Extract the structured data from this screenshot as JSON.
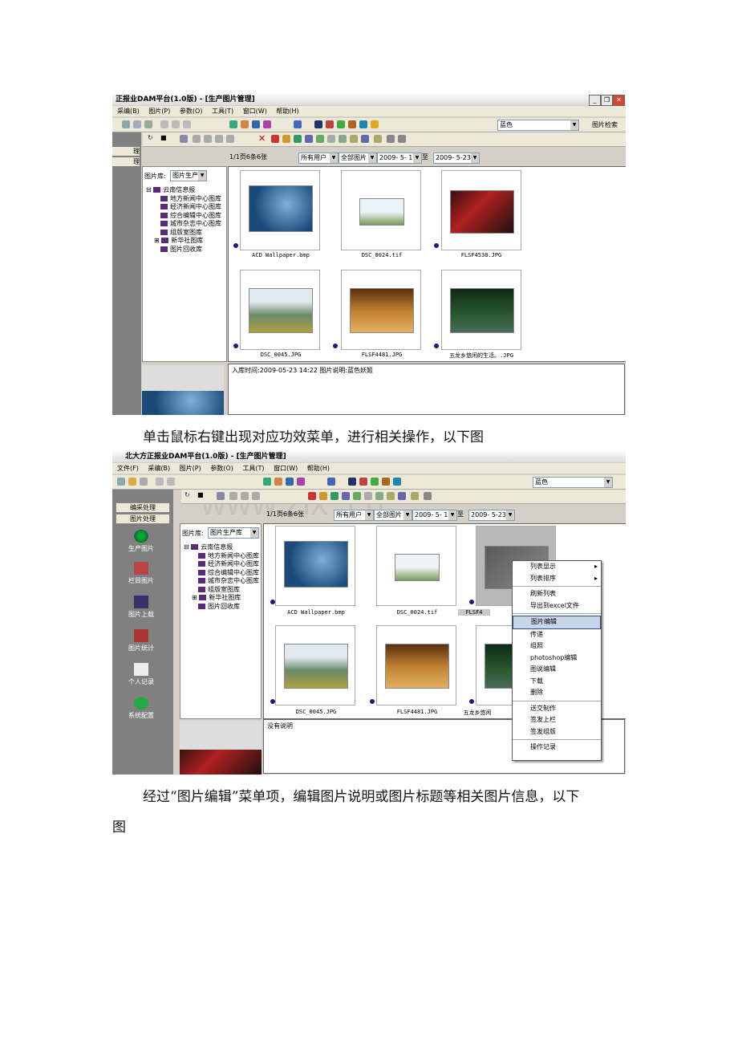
{
  "shot1": {
    "title": "正报业DAM平台(1.0版) - [生产图片管理]",
    "menus": [
      "采编(B)",
      "图片(P)",
      "参数(O)",
      "工具(T)",
      "窗口(W)",
      "帮助(H)"
    ],
    "color_combo": "蓝色",
    "search_label": "图片检索",
    "sidebar_labels": [
      "理",
      "理"
    ],
    "page_info": "1/1页6条6张",
    "user_combo": "所有用户",
    "type_combo": "全部图片",
    "date_from": "2009- 5- 1",
    "to_label": "至",
    "date_to": "2009- 5-23",
    "library_label": "图片库:",
    "library_combo": "图片生产库",
    "tree": [
      "云南信息报",
      "地方新闻中心图库",
      "经济新闻中心图库",
      "综合编辑中心图库",
      "城市杂志中心图库",
      "组版室图库",
      "新华社图库",
      "图片回收库"
    ],
    "photos": [
      "ACD Wallpaper.bmp",
      "DSC_0024.tif",
      "FLSF4538.JPG",
      "DSC_0045.JPG",
      "FLSF4481.JPG",
      "五龙乡悠闲的生活。.JPG"
    ],
    "info_text": "入库时间:2009-05-23 14:22 图片说明:蓝色妖姬"
  },
  "caption1": "单击鼠标右键出现对应功效菜单，进行相关操作，以下图",
  "shot2": {
    "title": "北大方正报业DAM平台(1.0版) - [生产图片管理]",
    "menus": [
      "文件(F)",
      "采编(B)",
      "图片(P)",
      "参数(O)",
      "工具(T)",
      "窗口(W)",
      "帮助(H)"
    ],
    "color_combo": "蓝色",
    "tabs": [
      "编采处理",
      "图片处理"
    ],
    "side_buttons": [
      "生产图片",
      "栏目图片",
      "图片上载",
      "图片统计",
      "个人记录",
      "系统配置"
    ],
    "page_info": "1/1页6条6张",
    "user_combo": "所有用户",
    "type_combo": "全部图片",
    "date_from": "2009- 5- 1",
    "to_label": "至",
    "date_to": "2009- 5-23",
    "library_label": "图片库:",
    "library_combo": "图片生产库",
    "tree": [
      "云南信息报",
      "地方新闻中心图库",
      "经济新闻中心图库",
      "综合编辑中心图库",
      "城市杂志中心图库",
      "组版室图库",
      "新华社图库",
      "图片回收库"
    ],
    "photos": [
      "ACD Wallpaper.bmp",
      "DSC_0024.tif",
      "FLSF4",
      "DSC_0045.JPG",
      "FLSF4481.JPG",
      "五龙乡悠闲"
    ],
    "info_text": "没有说明",
    "context_menu": [
      "列表显示",
      "列表排序",
      "刷新列表",
      "导出到excel文件",
      "图片编辑",
      "传递",
      "组照",
      "photoshop编辑",
      "图说编辑",
      "下载",
      "删除",
      "送交制作",
      "签发上栏",
      "签发组版",
      "操作记录"
    ],
    "watermark": "www.zix  .cn"
  },
  "caption2_line1": "经过“图片编辑”菜单项，编辑图片说明或图片标题等相关图片信息，以下",
  "caption2_line2": "图"
}
